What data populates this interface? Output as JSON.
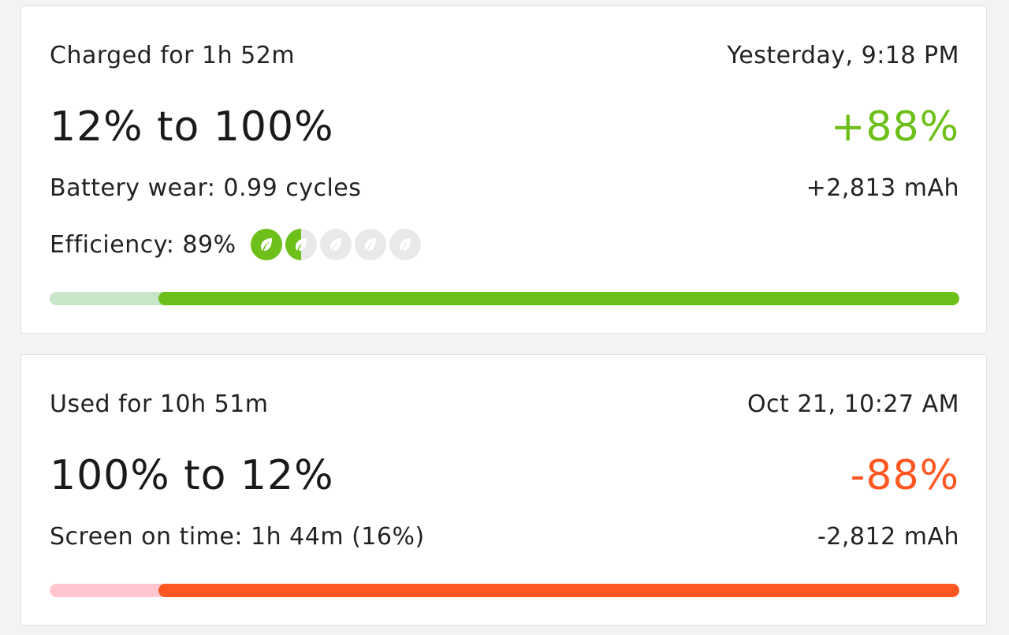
{
  "colors": {
    "charge_accent": "#6dbf19",
    "charge_track": "#c9e5c8",
    "usage_accent": "#ff5722",
    "usage_track": "#ffc6cf",
    "leaf_empty": "#e9e9e9"
  },
  "charge_session": {
    "duration": "Charged for 1h 52m",
    "timestamp": "Yesterday, 9:18 PM",
    "range": "12% to 100%",
    "delta_percent": "+88%",
    "battery_wear": "Battery wear: 0.99 cycles",
    "delta_mah": "+2,813 mAh",
    "efficiency_label": "Efficiency: 89%",
    "efficiency_leaves": [
      1,
      0.5,
      0,
      0,
      0
    ],
    "leaf_icon": "leaf-icon",
    "bar": {
      "start_percent": 12,
      "end_percent": 100
    }
  },
  "usage_session": {
    "duration": "Used for 10h 51m",
    "timestamp": "Oct 21, 10:27 AM",
    "range": "100% to 12%",
    "delta_percent": "-88%",
    "screen_on_time": "Screen on time: 1h 44m (16%)",
    "delta_mah": "-2,812 mAh",
    "bar": {
      "start_percent": 12,
      "end_percent": 100
    }
  }
}
